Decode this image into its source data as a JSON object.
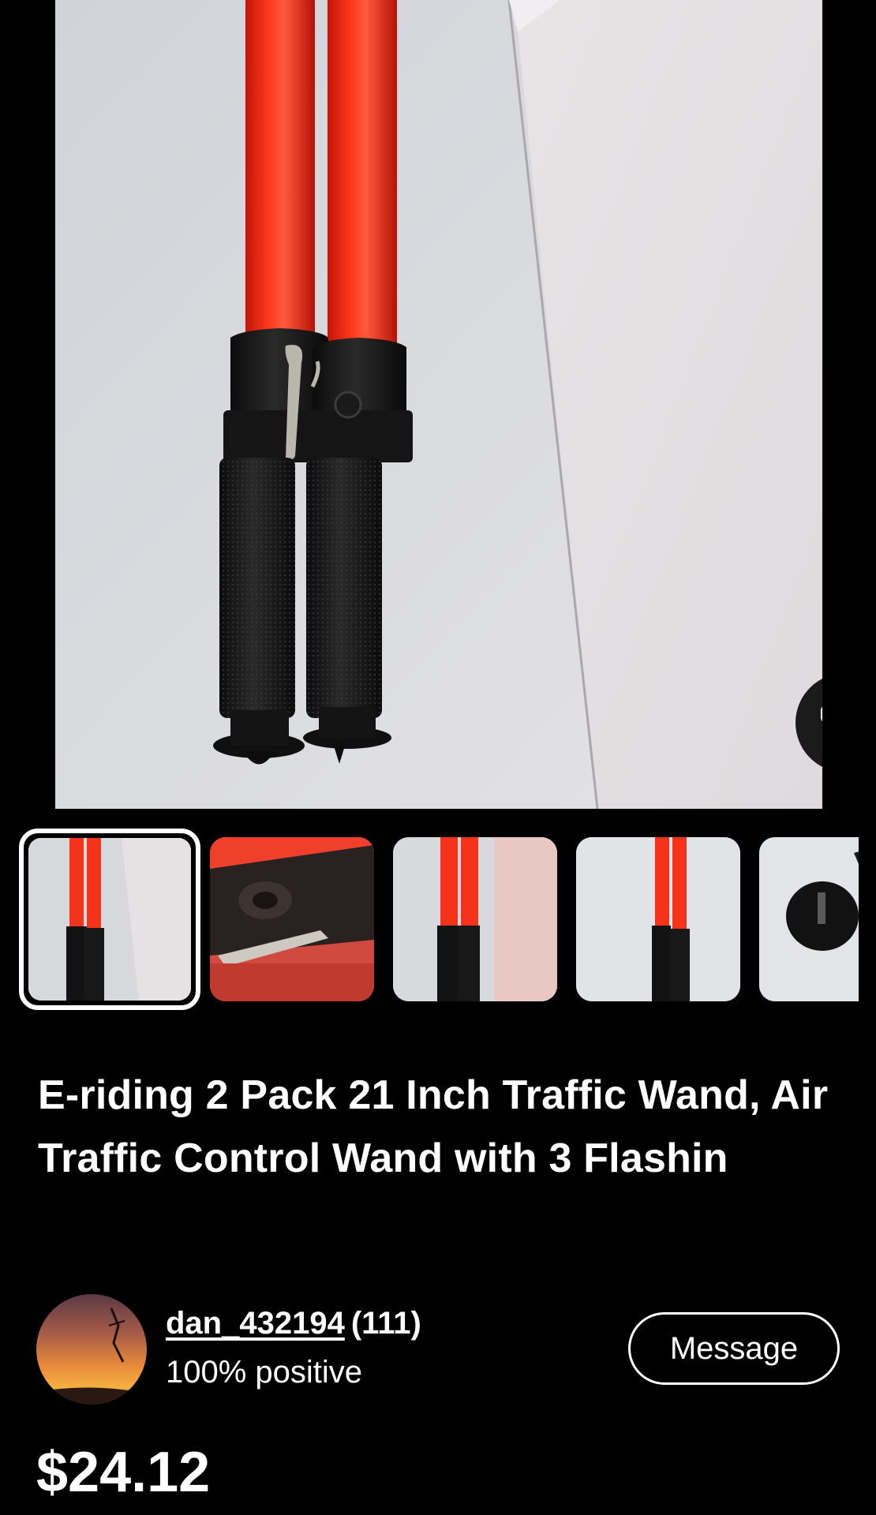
{
  "listing": {
    "title": "E-riding 2 Pack 21 Inch Traffic Wand, Air Traffic Control Wand with 3 Flashin",
    "price": "$24.12"
  },
  "gallery": {
    "photo_count": 5,
    "selected_index": 0,
    "favorite_icon": "heart-outline-icon"
  },
  "seller": {
    "username": "dan_432194",
    "feedback_count": "(111)",
    "feedback_percent": "100% positive",
    "message_label": "Message"
  },
  "colors": {
    "background": "#000000",
    "text": "#ffffff",
    "wand_red": "#ff2a14",
    "favorite_button": "#1b1b1b"
  }
}
